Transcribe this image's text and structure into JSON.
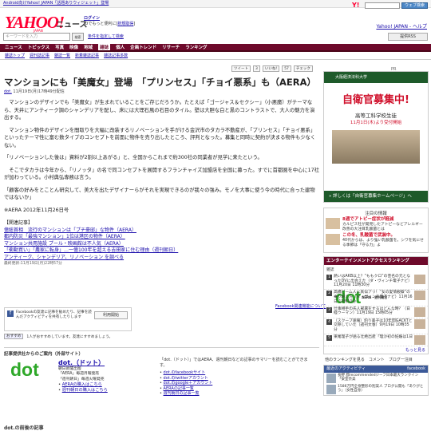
{
  "topbar": {
    "promo": "Android向けYahoo! JAPAN「話題ありウィジェット」登場",
    "search_button": "ウェブ検索"
  },
  "header": {
    "logo": "YAHOO!",
    "logo_sub": "JAPAN",
    "section": "ニュース",
    "login_label": "ログイン",
    "login_desc": "IDでもっと便利に[",
    "signup": "新規取得",
    "help": "Yahoo! JAPAN - ヘルプ"
  },
  "keywordbar": {
    "placeholder": "キーワードを入力",
    "search": "検索",
    "advanced": "条件を指定して検索",
    "rss": "提供RSS"
  },
  "nav": {
    "items": [
      "ニュース",
      "トピックス",
      "写真",
      "映像",
      "地域",
      "雑誌",
      "個人",
      "企画トレンド",
      "リサーチ",
      "ランキング"
    ],
    "active": "雑誌"
  },
  "subnav": [
    "雑誌トップ",
    "週刊誌記事",
    "雑誌一覧",
    "新着雑誌記事",
    "雑誌記事多数"
  ],
  "social": {
    "tweet": "ツイート",
    "tweet_count": "3",
    "like": "いいね!",
    "like_count": "57",
    "check": "チェック"
  },
  "pr_label": "PR",
  "article": {
    "title": "マンションにも「美魔女」登場　「プリンセス」「チョイ悪系」も（AERA）",
    "source_link": "dot.",
    "meta": " 11月19日(月)17時49分配信",
    "paragraphs": [
      "　マンションのデザインでも「美魔女」が生まれていることをご存じだろうか。たとえば「ゴージャス＆セクシー」（小悪魔）がテーマなら、天井にアンティーク調のシャンデリアを配し、床には大理石風の石目のタイル。壁は大胆な白と黒のコントラストで、大人の魅力を演出する。",
      "　マンション物件のデザインを間取りを大幅に改装するリノベーションを手がける金沢市のタカラ不動産が、「プリンセス」「チョイ悪系」といったテーマ性に富む数タイプのコンセプトを前面に物件を売り出したところ、評判となった。募集と同時に契約が決まる物件も少なくない。",
      "「リノベーションした後は」資料が2割以上あがる」と、全国からこれまで約300社の同業者が見学に来たという。",
      "　そこでタカラは今年から、「リノッタ」の名で同コンセプトを展開するフランチャイズ加盟店を全国に募った。すでに首都圏を中心に17社が加わっている。小村典弘専務は言う。",
      "「顧客の好みをとことん研究して、美大を出たデザイナーらがそれを実現できるのが我々の強み。モノを大事に使う今の時代に合った建物ではないか」",
      "※AERA 2012年11月26日号"
    ],
    "related_heading": "【関連記事】",
    "related": [
      "億総首相　流行のマンションは「プチ豪邸」な物件（AERA）",
      "都内防災「最強マンション」1位は港区の物件（AERA）",
      "マンション共用施設  プール・映画館は不人気（AERA）",
      "「衝動買い」「農家に転身」…一億100年を超える吉田家に住む理由（週刊朝日）",
      "アンティーク、シャンデリア、リノベーション を調べる"
    ],
    "last_updated": "最終更新:11月19日(月)22時57分"
  },
  "dot_logo": {
    "main": "dot",
    "sub": "AERA・週刊朝日"
  },
  "fb_related": "Facebook関連機能について",
  "fb_box": {
    "text": "Facebookの友達に記事を勧めたり、記事を読んだアクティビティを共有したりします",
    "button": "利用開始"
  },
  "like_row": {
    "button": "おすすめ",
    "text": "1人がおすすめしています。友達にすすめましょう。"
  },
  "source": {
    "heading": "記事提供社からのご案内（外部サイト）",
    "name": "dot.（ドット）",
    "company": "朝日新聞出版",
    "desc1": "「AERA」毎週月曜発売",
    "desc2": "「週刊朝日」毎週火曜発売",
    "link1": "AERAの購入はこちら",
    "link2": "週刊朝日の購入はこちら",
    "right_intro": "「dot.（ドット）」ではAERA、週刊朝日などの記事のサマリーを読むことができます。",
    "right_links": [
      "dot.のfacebookサイト",
      "dot.のtwitterアカウント",
      "dot.のgoogle＋アカウント",
      "AERAの記事一覧",
      "週刊朝日の記事一覧"
    ]
  },
  "next_heading": "dot.の前後の記事",
  "sidebar": {
    "ad_org": "大阪経済法科大学",
    "ad_headline": "自衛官募集中!",
    "ad_school": "高等工科学校生徒",
    "ad_date": "11月1日(木)より受付開始",
    "ad_bottom": "» 詳しくは「自衛官募集ホームページ」へ",
    "feature_title": "注目の情報",
    "features": [
      {
        "title": "8週でアトピー症状が軽減",
        "desc": "カルピス社が発見したアトピーなどアレルギー改善の大注目乳酸菌とは"
      },
      {
        "title": "この冬、乳酸菌で武装中。",
        "desc": "40代からは、より強い乳酸菌を。シワを気にせる季節は「守る力」よ"
      }
    ],
    "ranking_head": "エンターテインメントアクセスランキング",
    "ranking_cat": "雑誌",
    "ranking": [
      {
        "n": "1",
        "t": "熱いはAKB以上？“ももクロ”の芸名の元となったDVに出会えた（ダ・ヴィンチ電子ナビ）11月20日 11時30分"
      },
      {
        "n": "2",
        "t": "高橋ビーム人に真似アリ！“女の愛情観察”の乗り越え方（ダ・ヴィンチ電子ナビ）11月16日 13時10分"
      },
      {
        "n": "3",
        "t": "仕事相手の先人部署をするはどんな時？（日経ウーマン）11月19日 15時05分"
      },
      {
        "n": "4",
        "t": "（スクープ速報）釣り美子は10年間GACKTと交際していた（週刊文春）9月19日 10時35分"
      },
      {
        "n": "5",
        "t": "東尾理子が語る壮絶出産「理沙初の妊娠は1日"
      }
    ],
    "ranking_more": "もっと見る",
    "other_sites": "他のランキングを見る　コメント　ブログ一注目",
    "activity_head": "最近のアクティビティ",
    "activity_fb": "facebook",
    "activity": [
      "長野 郡recommendedジーフ日本最大ランクイン「安室奈美",
      "1586万円全身整形の別案人 ブログ公開も「ありがとう」（女性自身）"
    ]
  }
}
